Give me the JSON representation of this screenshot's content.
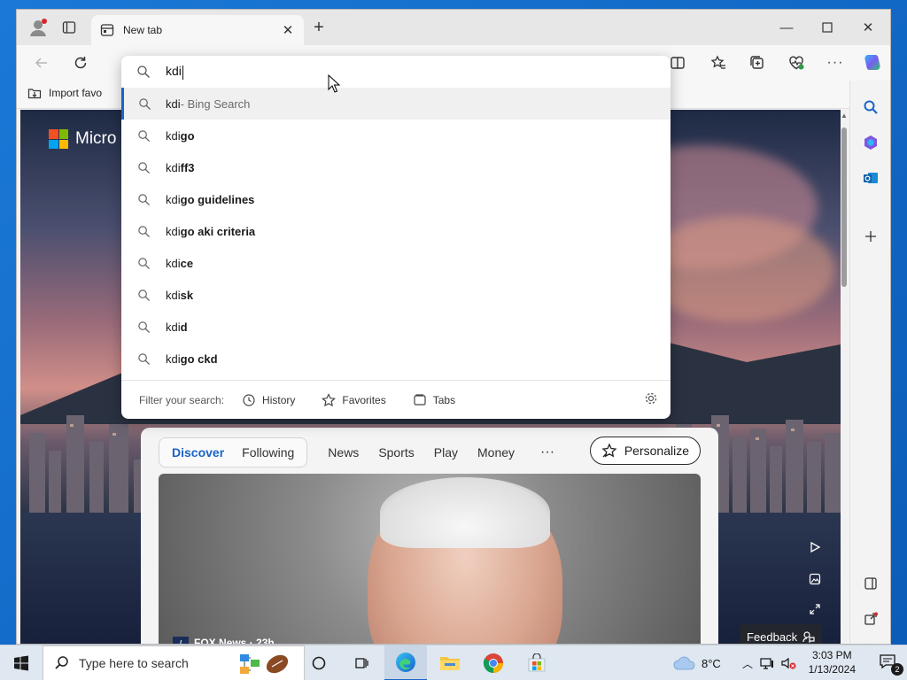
{
  "browser": {
    "tab_title": "New tab",
    "favorites_bar": {
      "import_label": "Import favo"
    }
  },
  "address_bar": {
    "value": "kdi",
    "suggestions": [
      {
        "prefix": "kdi",
        "suffix": "",
        "muted": " - Bing Search"
      },
      {
        "prefix": "kdi",
        "suffix": "go",
        "muted": ""
      },
      {
        "prefix": "kdi",
        "suffix": "ff3",
        "muted": ""
      },
      {
        "prefix": "kdi",
        "suffix": "go guidelines",
        "muted": ""
      },
      {
        "prefix": "kdi",
        "suffix": "go aki criteria",
        "muted": ""
      },
      {
        "prefix": "kdi",
        "suffix": "ce",
        "muted": ""
      },
      {
        "prefix": "kdi",
        "suffix": "sk",
        "muted": ""
      },
      {
        "prefix": "kdi",
        "suffix": "d",
        "muted": ""
      },
      {
        "prefix": "kdi",
        "suffix": "go ckd",
        "muted": ""
      }
    ],
    "filter": {
      "label": "Filter your search:",
      "history": "History",
      "favorites": "Favorites",
      "tabs": "Tabs"
    }
  },
  "ntp": {
    "logo_text": "Micro",
    "feed_tabs": {
      "discover": "Discover",
      "following": "Following",
      "news": "News",
      "sports": "Sports",
      "play": "Play",
      "money": "Money",
      "more": "···"
    },
    "personalize": "Personalize",
    "hero_source": "FOX News · 23h",
    "feedback": "Feedback"
  },
  "taskbar": {
    "search_placeholder": "Type here to search",
    "weather": "8°C",
    "time": "3:03 PM",
    "date": "1/13/2024",
    "notifications": "2"
  },
  "colors": {
    "accent": "#1a64c9",
    "desktop": "#0b5cb8"
  }
}
